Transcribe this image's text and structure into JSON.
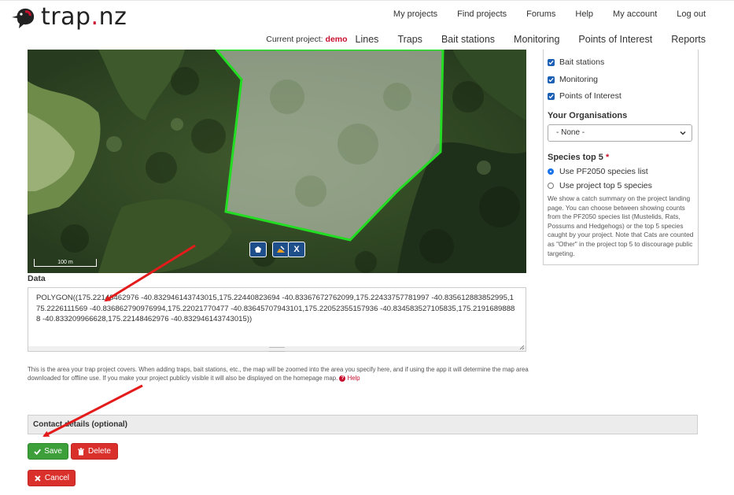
{
  "brand": {
    "name_main": "trap",
    "name_dot": ".",
    "name_tld": "nz"
  },
  "topnav": [
    "My projects",
    "Find projects",
    "Forums",
    "Help",
    "My account",
    "Log out"
  ],
  "subnav": {
    "current_label": "Current project:",
    "current_value": "demo",
    "links": [
      "Lines",
      "Traps",
      "Bait stations",
      "Monitoring",
      "Points of Interest",
      "Reports"
    ]
  },
  "map": {
    "scale_label": "100 m",
    "controls": [
      "pentagon-tool-icon",
      "edit-polygon-icon",
      "close-icon"
    ],
    "close_label": "X"
  },
  "panel": {
    "checkboxes": [
      {
        "label": "Bait stations",
        "checked": true
      },
      {
        "label": "Monitoring",
        "checked": true
      },
      {
        "label": "Points of Interest",
        "checked": true
      }
    ],
    "org_heading": "Your Organisations",
    "org_select_value": "- None -",
    "species_heading": "Species top 5",
    "species_required": "*",
    "species_options": [
      {
        "label": "Use PF2050 species list",
        "selected": true
      },
      {
        "label": "Use project top 5 species",
        "selected": false
      }
    ],
    "species_note": "We show a catch summary on the project landing page. You can choose between showing counts from the PF2050 species list (Mustelids, Rats, Possums and Hedgehogs) or the top 5 species caught by your project. Note that Cats are counted as \"Other\" in the project top 5 to discourage public targeting."
  },
  "data_field": {
    "label": "Data",
    "value": "POLYGON((175.22148462976 -40.832946143743015,175.22440823694 -40.83367672762099,175.22433757781997 -40.835612883852995,175.2226111569 -40.836862790976994,175.22021770477 -40.83645707943101,175.22052355157936 -40.834583527105835,175.21916898888 -40.833209966628,175.22148462976 -40.832946143743015))",
    "help": "This is the area your trap project covers. When adding traps, bait stations, etc., the map will be zoomed into the area you specify here, and if using the app it will determine the map area downloaded for offline use. If you make your project publicly visible it will also be displayed on the homepage map.",
    "help_link": "Help"
  },
  "contact": {
    "label": "Contact details (optional)"
  },
  "buttons": {
    "save": "Save",
    "delete": "Delete",
    "cancel": "Cancel"
  },
  "colors": {
    "brand_red": "#c8102e",
    "save_green": "#3c9f3a",
    "danger_red": "#d9302c",
    "polygon_green": "#22dd22",
    "arrow_red": "#e31b1b"
  }
}
